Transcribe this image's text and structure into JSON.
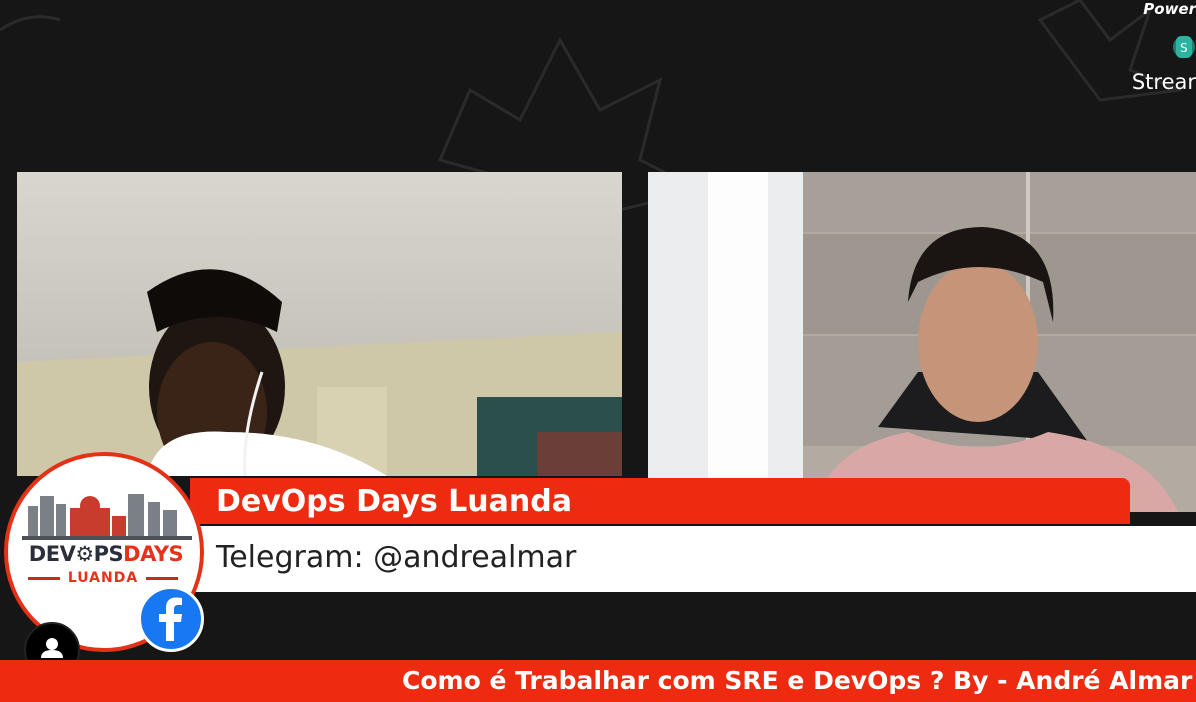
{
  "branding": {
    "powered_label": "Power",
    "stream_label": "Strear"
  },
  "lower_third": {
    "title": "DevOps Days Luanda",
    "subtitle": "Telegram: @andrealmar"
  },
  "event_logo": {
    "name_dark_1": "DEV",
    "name_dark_2": "PS",
    "name_red": "DAYS",
    "city": "LUANDA"
  },
  "ticker": {
    "text": "Como é Trabalhar com SRE e DevOps ? By - André Almar -"
  },
  "icons": {
    "facebook": "facebook-icon",
    "avatar": "user-avatar-icon",
    "gear": "gear-icon"
  },
  "colors": {
    "accent": "#ee2a10",
    "background": "#161616",
    "facebook": "#1877f2"
  }
}
